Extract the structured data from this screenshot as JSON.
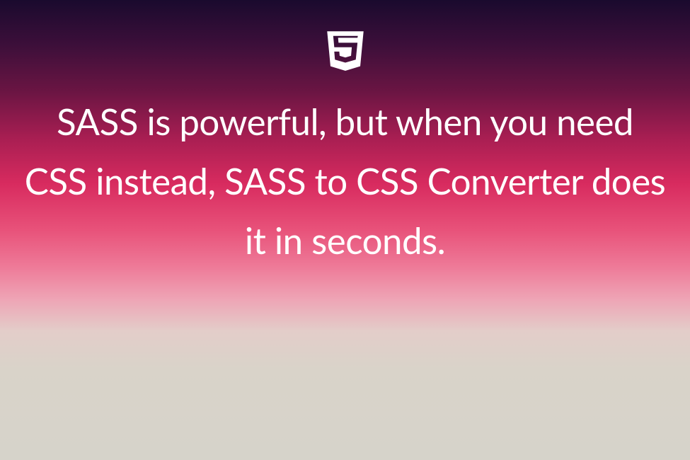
{
  "icon": {
    "name": "css3-shield-icon"
  },
  "headline": "SASS is powerful, but when you need CSS instead, SASS to CSS Converter does it in seconds."
}
